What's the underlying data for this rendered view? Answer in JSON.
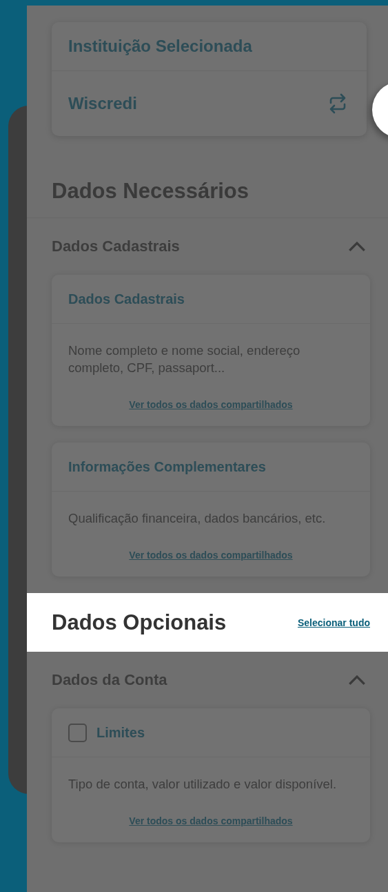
{
  "institution": {
    "label": "Instituição Selecionada",
    "name": "Wiscredi"
  },
  "required": {
    "title": "Dados Necessários",
    "groups": [
      {
        "title": "Dados Cadastrais",
        "expanded": true,
        "cards": [
          {
            "kind": "plain",
            "title": "Dados Cadastrais",
            "description": "Nome completo e nome social, endereço completo, CPF, passaport...",
            "link": "Ver todos os dados compartilhados"
          },
          {
            "kind": "plain",
            "title": "Informações Complementares",
            "description": "Qualificação financeira, dados bancários, etc.",
            "link": "Ver todos os dados compartilhados"
          }
        ]
      }
    ]
  },
  "optional": {
    "title": "Dados Opcionais",
    "action": "Selecionar tudo",
    "groups": [
      {
        "title": "Dados da Conta",
        "expanded": true,
        "cards": [
          {
            "kind": "checkbox",
            "checked": false,
            "title": "Limites",
            "description": "Tipo de conta, valor utilizado e valor disponível.",
            "link": "Ver todos os dados compartilhados"
          }
        ]
      }
    ]
  }
}
